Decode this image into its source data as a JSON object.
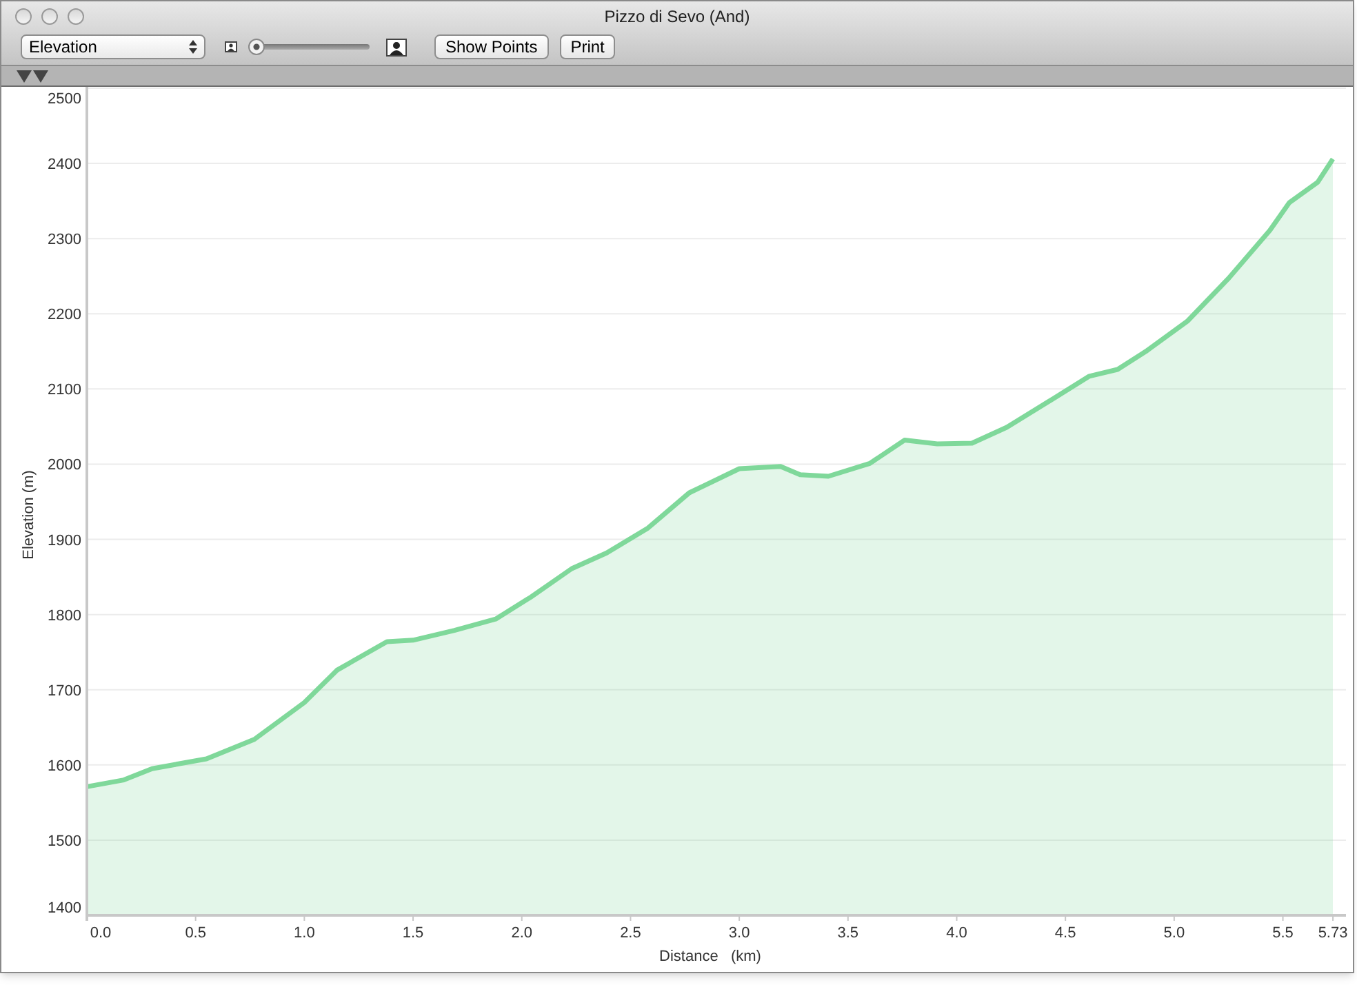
{
  "window": {
    "title": "Pizzo di Sevo (And)"
  },
  "toolbar": {
    "view_select": {
      "value": "Elevation"
    },
    "zoom_slider": {
      "level": 0
    },
    "buttons": [
      "Show Points",
      "Print"
    ]
  },
  "chart": {
    "chart_data": {
      "type": "area",
      "xlabel": "Distance   (km)",
      "ylabel": "Elevation (m)",
      "x": [
        0,
        0.17,
        0.3,
        0.55,
        0.77,
        1.0,
        1.15,
        1.38,
        1.5,
        1.69,
        1.88,
        2.04,
        2.23,
        2.39,
        2.58,
        2.77,
        3.0,
        3.19,
        3.28,
        3.41,
        3.6,
        3.76,
        3.91,
        4.07,
        4.23,
        4.42,
        4.61,
        4.74,
        4.87,
        5.06,
        5.25,
        5.44,
        5.53,
        5.66,
        5.73
      ],
      "series": [
        {
          "color": "#7fd89a",
          "values": [
            1571,
            1580,
            1595,
            1608,
            1634,
            1683,
            1726,
            1764,
            1766,
            1779,
            1794,
            1823,
            1861,
            1882,
            1915,
            1962,
            1994,
            1997,
            1986,
            1984,
            2001,
            2032,
            2027,
            2028,
            2049,
            2083,
            2117,
            2126,
            2150,
            2190,
            2247,
            2311,
            2348,
            2375,
            2406
          ]
        }
      ],
      "xlim": [
        0,
        5.79
      ],
      "grid": true,
      "ylim": [
        1400,
        2500
      ],
      "xticks": [
        {
          "value": 0,
          "label": "0.0"
        },
        {
          "value": 0.5,
          "label": "0.5"
        },
        {
          "value": 1,
          "label": "1.0"
        },
        {
          "value": 1.5,
          "label": "1.5"
        },
        {
          "value": 2,
          "label": "2.0"
        },
        {
          "value": 2.5,
          "label": "2.5"
        },
        {
          "value": 3,
          "label": "3.0"
        },
        {
          "value": 3.5,
          "label": "3.5"
        },
        {
          "value": 4,
          "label": "4.0"
        },
        {
          "value": 4.5,
          "label": "4.5"
        },
        {
          "value": 5,
          "label": "5.0"
        },
        {
          "value": 5.5,
          "label": "5.5"
        },
        {
          "value": 5.73,
          "label": "5.73"
        }
      ],
      "yticks": [
        1400,
        1500,
        1600,
        1700,
        1800,
        1900,
        2000,
        2100,
        2200,
        2300,
        2400,
        2500
      ]
    }
  }
}
